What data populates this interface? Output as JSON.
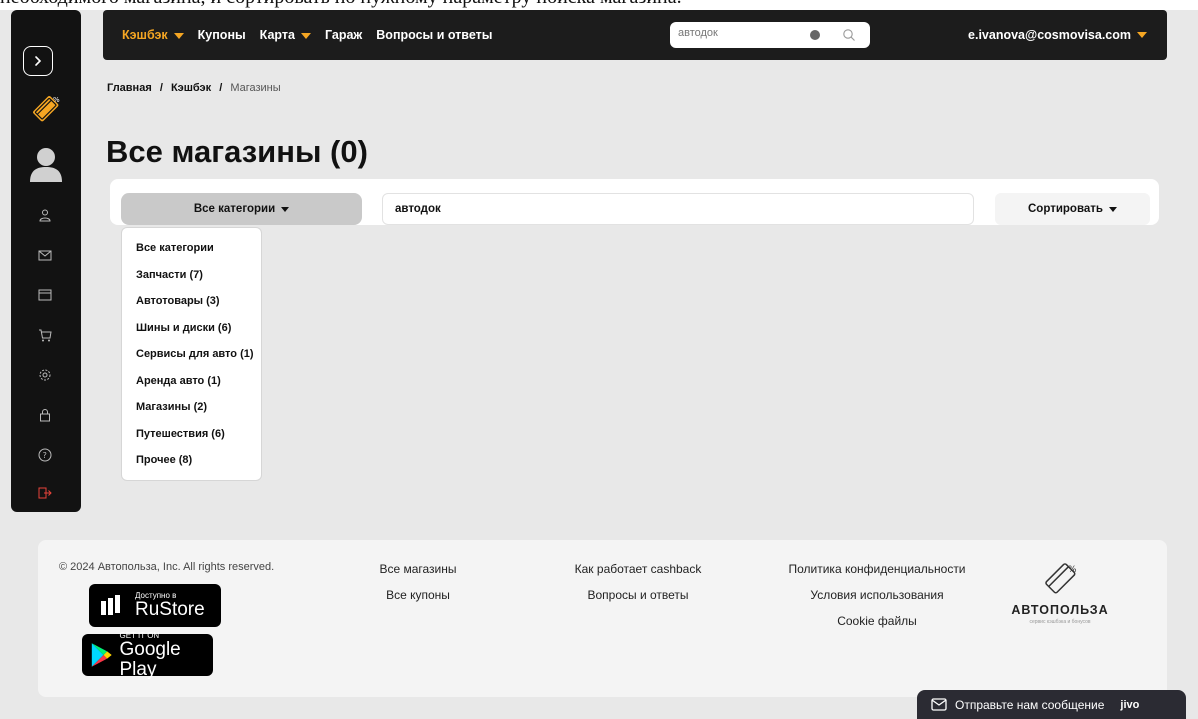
{
  "caption": "необходимого магазина, и сортировать по нужному параметру поиска магазина.",
  "nav": {
    "items": [
      {
        "label": "Кэшбэк",
        "dropdown": true,
        "active": true
      },
      {
        "label": "Купоны",
        "dropdown": false,
        "active": false
      },
      {
        "label": "Карта",
        "dropdown": true,
        "active": false
      },
      {
        "label": "Гараж",
        "dropdown": false,
        "active": false
      },
      {
        "label": "Вопросы и ответы",
        "dropdown": false,
        "active": false
      }
    ],
    "search_value": "автодок",
    "user_email": "e.ivanova@cosmovisa.com"
  },
  "breadcrumb": {
    "home": "Главная",
    "sep": "/",
    "parent": "Кэшбэк",
    "current": "Магазины"
  },
  "page_title": "Все магазины (0)",
  "filters": {
    "category_label": "Все категории",
    "search_value": "автодок",
    "sort_label": "Сортировать"
  },
  "categories": [
    "Все категории",
    "Запчасти (7)",
    "Автотовары (3)",
    "Шины и диски (6)",
    "Сервисы для авто (1)",
    "Аренда авто (1)",
    "Магазины (2)",
    "Путешествия (6)",
    "Прочее (8)"
  ],
  "footer": {
    "copyright": "© 2024 Автопольза, Inc. All rights reserved.",
    "rustore_small": "Доступно в",
    "rustore_big": "RuStore",
    "gplay_small": "GET IT ON",
    "gplay_big": "Google Play",
    "col1": [
      "Все магазины",
      "Все купоны"
    ],
    "col2": [
      "Как работает cashback",
      "Вопросы и ответы"
    ],
    "col3": [
      "Политика конфиденциальности",
      "Условия использования",
      "Cookie файлы"
    ],
    "brand": "АВТОПОЛЬЗА",
    "brand_tagline": "сервис кэшбэка и бонусов"
  },
  "chat": {
    "label": "Отправьте нам сообщение",
    "brand": "jivo"
  },
  "colors": {
    "accent": "#f5a623",
    "sidebar_bg": "#121212",
    "topbar_bg": "#1c1c1c",
    "logout": "#e8433a"
  },
  "sidebar_icons": [
    "chevron-right-icon",
    "logo-icon",
    "avatar-icon",
    "user-icon",
    "mail-icon",
    "window-icon",
    "cart-icon",
    "gear-icon",
    "lock-icon",
    "help-icon",
    "logout-icon"
  ]
}
